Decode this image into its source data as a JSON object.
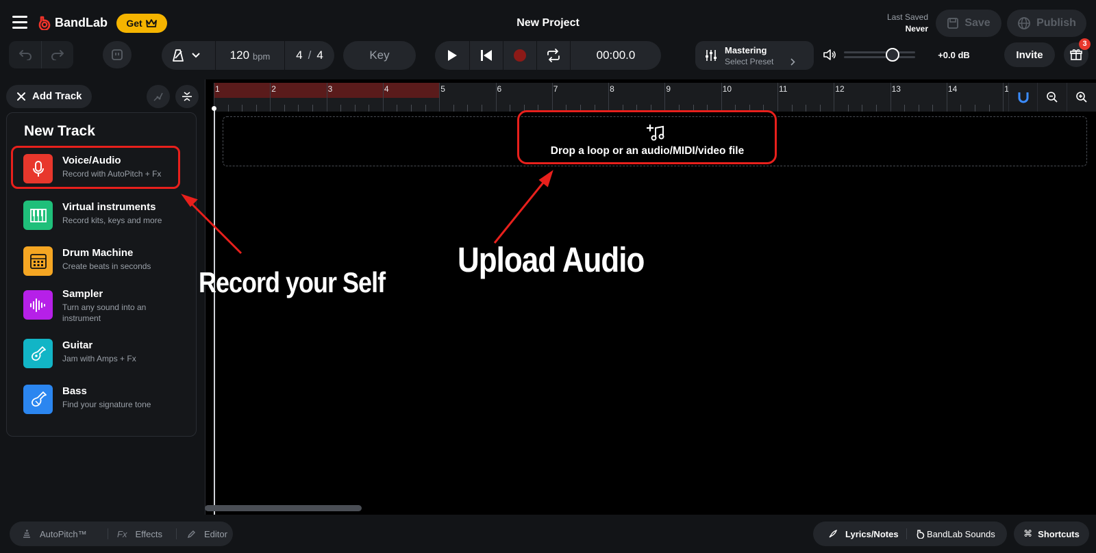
{
  "header": {
    "app_name": "BandLab",
    "get_label": "Get",
    "project_title": "New Project",
    "last_saved_label": "Last Saved",
    "last_saved_value": "Never",
    "save_label": "Save",
    "publish_label": "Publish"
  },
  "controls": {
    "tempo_value": "120",
    "tempo_unit": "bpm",
    "time_sig_num": "4",
    "time_sig_sep": "/",
    "time_sig_den": "4",
    "key_label": "Key",
    "time_display": "00:00.0",
    "mastering_label": "Mastering",
    "mastering_preset": "Select Preset",
    "volume_db": "+0.0 dB",
    "volume_level": 0.68,
    "invite_label": "Invite",
    "gift_badge": "3"
  },
  "sidebar": {
    "add_track_label": "Add Track",
    "panel_title": "New Track",
    "tracks": [
      {
        "title": "Voice/Audio",
        "subtitle": "Record with AutoPitch + Fx",
        "icon": "microphone-icon",
        "color": "#e8372c"
      },
      {
        "title": "Virtual instruments",
        "subtitle": "Record kits, keys and more",
        "icon": "piano-keys-icon",
        "color": "#1fbf7a"
      },
      {
        "title": "Drum Machine",
        "subtitle": "Create beats in seconds",
        "icon": "drum-machine-icon",
        "color": "#f5a623"
      },
      {
        "title": "Sampler",
        "subtitle": "Turn any sound into an instrument",
        "icon": "waveform-icon",
        "color": "#b620e8"
      },
      {
        "title": "Guitar",
        "subtitle": "Jam with Amps + Fx",
        "icon": "guitar-icon",
        "color": "#12b5c6"
      },
      {
        "title": "Bass",
        "subtitle": "Find your signature tone",
        "icon": "bass-icon",
        "color": "#2b86f0"
      }
    ]
  },
  "timeline": {
    "bars": [
      "1",
      "2",
      "3",
      "4",
      "5",
      "6",
      "7",
      "8",
      "9",
      "10",
      "11",
      "12",
      "13",
      "14",
      "1"
    ],
    "drop_text": "Drop a loop or an audio/MIDI/video file"
  },
  "annotations": {
    "record_text": "Record your Self",
    "upload_text": "Upload Audio"
  },
  "bottom": {
    "autopitch_label": "AutoPitch™",
    "effects_prefix": "Fx",
    "effects_label": "Effects",
    "editor_label": "Editor",
    "lyrics_label": "Lyrics/Notes",
    "sounds_label": "BandLab Sounds",
    "shortcuts_label": "Shortcuts"
  },
  "colors": {
    "brand_red": "#f0332a",
    "get_yellow": "#f5b400",
    "highlight_red": "#e8201c",
    "magnet_blue": "#3b8cff"
  }
}
